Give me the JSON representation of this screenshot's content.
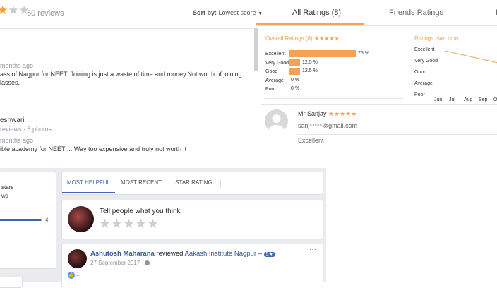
{
  "left_review": {
    "stars_filled": 1,
    "stars_total": 3,
    "review_count": "60 reviews",
    "sort_label": "Sort by:",
    "sort_value": "Lowest score",
    "reviews": [
      {
        "time": "months ago",
        "text_line1": "ass of Nagpur for NEET. Joining is just a waste of time and money.Not worth of joining",
        "text_line2": "lasses."
      },
      {
        "name": "eshwari",
        "meta": "reviews · 5 photos",
        "time": "months ago",
        "text_line1": "ible academy for NEET ....Way too expensive and truly not worth it"
      }
    ]
  },
  "tabs": {
    "all_ratings": "All Ratings (8)",
    "friends_ratings": "Friends Ratings",
    "third": "F"
  },
  "overall": {
    "title": "Overall Ratings (8)",
    "stars": "★★★★★",
    "rows": [
      {
        "label": "Excellent",
        "pct_text": "75 %",
        "pct": 0.75
      },
      {
        "label": "Very Good",
        "pct_text": "12.5 %",
        "pct": 0.125
      },
      {
        "label": "Good",
        "pct_text": "12.5 %",
        "pct": 0.125
      },
      {
        "label": "Average",
        "pct_text": "0 %",
        "pct": 0
      },
      {
        "label": "Poor",
        "pct_text": "0 %",
        "pct": 0
      }
    ]
  },
  "ratings_over_time": {
    "title": "Ratings over time",
    "labels_y": [
      "Excellent",
      "Very Good",
      "Good",
      "Average",
      "Poor"
    ],
    "labels_x": [
      "Jun",
      "Jul",
      "Aug",
      "Sep",
      "O"
    ]
  },
  "reviewer": {
    "name": "Mr Sanjay",
    "stars": "★★★★★",
    "email": "sanj*****@gmail.com",
    "rating_text": "Excellent"
  },
  "fb_left": {
    "line1": "stars",
    "line2": "ws",
    "bar_value": "4"
  },
  "fb_tabs": [
    "MOST HELPFUL",
    "MOST RECENT",
    "STAR RATING"
  ],
  "compose": {
    "prompt": "Tell people what you think",
    "stars": "★★★★★"
  },
  "post": {
    "author": "Ashutosh Maharana",
    "action": "reviewed",
    "target": "Aakash Institute Nagpur",
    "dash": "–",
    "badge": "5★",
    "date": "27 September 2017 ·",
    "likes": "1",
    "more": "···"
  },
  "colors": {
    "orange": "#f5a259",
    "fb_blue": "#4267b2",
    "star_gold": "#f0a030"
  }
}
